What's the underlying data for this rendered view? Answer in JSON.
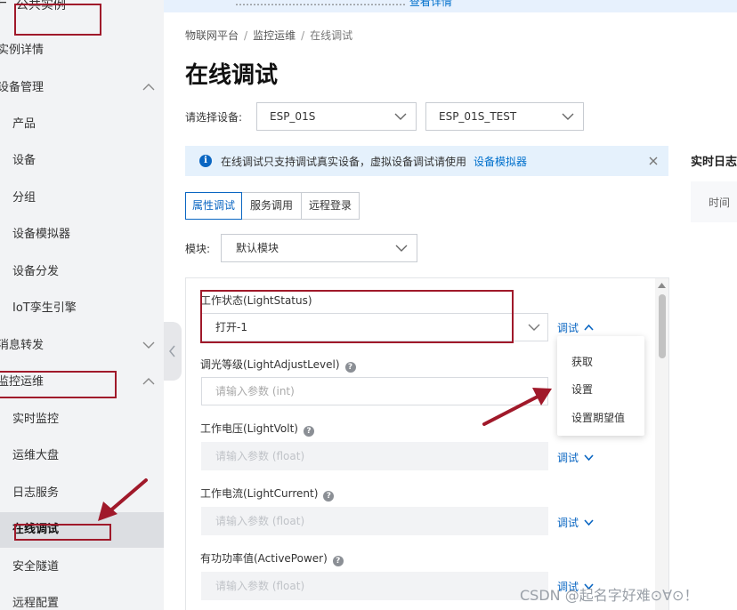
{
  "banner": {
    "text": "…………………………………………",
    "link": "查看详情"
  },
  "sidebar": {
    "header_title": "公共实例",
    "items": [
      {
        "label": "实例详情",
        "type": "group"
      },
      {
        "label": "设备管理",
        "type": "group",
        "expanded": true
      },
      {
        "label": "产品",
        "type": "sub"
      },
      {
        "label": "设备",
        "type": "sub"
      },
      {
        "label": "分组",
        "type": "sub"
      },
      {
        "label": "设备模拟器",
        "type": "sub"
      },
      {
        "label": "设备分发",
        "type": "sub"
      },
      {
        "label": "IoT孪生引擎",
        "type": "sub"
      },
      {
        "label": "消息转发",
        "type": "group",
        "expanded": false
      },
      {
        "label": "监控运维",
        "type": "group",
        "expanded": true
      },
      {
        "label": "实时监控",
        "type": "sub"
      },
      {
        "label": "运维大盘",
        "type": "sub"
      },
      {
        "label": "日志服务",
        "type": "sub"
      },
      {
        "label": "在线调试",
        "type": "sub",
        "active": true
      },
      {
        "label": "安全隧道",
        "type": "sub"
      },
      {
        "label": "远程配置",
        "type": "sub"
      }
    ]
  },
  "breadcrumb": [
    "物联网平台",
    "监控运维",
    "在线调试"
  ],
  "breadcrumb_sep": "/",
  "page_title": "在线调试",
  "device_select": {
    "label": "请选择设备:",
    "product": "ESP_01S",
    "device": "ESP_01S_TEST"
  },
  "info_bar": {
    "text": "在线调试只支持调试真实设备，虚拟设备调试请使用",
    "link": "设备模拟器"
  },
  "right_panel": {
    "title": "实时日志",
    "column": "时间"
  },
  "tabs": [
    {
      "label": "属性调试",
      "active": true
    },
    {
      "label": "服务调用",
      "active": false
    },
    {
      "label": "远程登录",
      "active": false
    }
  ],
  "module": {
    "label": "模块:",
    "value": "默认模块"
  },
  "properties": [
    {
      "label": "工作状态(LightStatus)",
      "help": false,
      "value": "打开-1",
      "placeholder": "",
      "disabled": false,
      "select": true,
      "action": "调试",
      "open": true
    },
    {
      "label": "调光等级(LightAdjustLevel)",
      "help": true,
      "value": "",
      "placeholder": "请输入参数 (int)",
      "disabled": false,
      "select": false,
      "action": "",
      "open": false
    },
    {
      "label": "工作电压(LightVolt)",
      "help": true,
      "value": "",
      "placeholder": "请输入参数 (float)",
      "disabled": true,
      "select": false,
      "action": "调试",
      "open": false
    },
    {
      "label": "工作电流(LightCurrent)",
      "help": true,
      "value": "",
      "placeholder": "请输入参数 (float)",
      "disabled": true,
      "select": false,
      "action": "调试",
      "open": false
    },
    {
      "label": "有功功率值(ActivePower)",
      "help": true,
      "value": "",
      "placeholder": "请输入参数 (float)",
      "disabled": true,
      "select": false,
      "action": "调试",
      "open": false
    }
  ],
  "help_glyph": "?",
  "dropdown": [
    "获取",
    "设置",
    "设置期望值"
  ],
  "watermark": "CSDN @起名字好难⊙∀⊙！",
  "colors": {
    "accent": "#0a66c2",
    "annotation": "#a0192a",
    "sidebar_bg": "#f2f3f5",
    "info_bg": "#e5f1fc"
  }
}
